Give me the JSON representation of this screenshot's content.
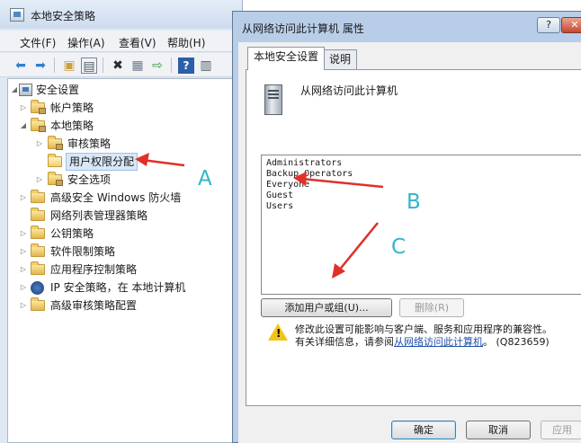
{
  "main_window": {
    "title": "本地安全策略",
    "menu": [
      "文件(F)",
      "操作(A)",
      "查看(V)",
      "帮助(H)"
    ],
    "toolbar_icons": [
      "back-arrow-icon",
      "forward-arrow-icon",
      "up-folder-icon",
      "show-hide-tree-icon",
      "delete-icon",
      "properties-icon",
      "export-icon",
      "help-icon",
      "view-icon"
    ],
    "tree": [
      {
        "label": "安全设置",
        "level": 0,
        "expanded": true,
        "icon": "computer"
      },
      {
        "label": "帐户策略",
        "level": 1,
        "expanded": false,
        "icon": "folder"
      },
      {
        "label": "本地策略",
        "level": 1,
        "expanded": true,
        "icon": "folder"
      },
      {
        "label": "审核策略",
        "level": 2,
        "expanded": false,
        "icon": "folder"
      },
      {
        "label": "用户权限分配",
        "level": 2,
        "expanded": null,
        "icon": "folder-open",
        "selected": true
      },
      {
        "label": "安全选项",
        "level": 2,
        "expanded": false,
        "icon": "folder"
      },
      {
        "label": "高级安全 Windows 防火墙",
        "level": 1,
        "expanded": false,
        "icon": "folder"
      },
      {
        "label": "网络列表管理器策略",
        "level": 1,
        "expanded": null,
        "icon": "folder"
      },
      {
        "label": "公钥策略",
        "level": 1,
        "expanded": false,
        "icon": "folder"
      },
      {
        "label": "软件限制策略",
        "level": 1,
        "expanded": false,
        "icon": "folder"
      },
      {
        "label": "应用程序控制策略",
        "level": 1,
        "expanded": false,
        "icon": "folder"
      },
      {
        "label": "IP 安全策略，在 本地计算机",
        "level": 1,
        "expanded": false,
        "icon": "ip"
      },
      {
        "label": "高级审核策略配置",
        "level": 1,
        "expanded": false,
        "icon": "folder"
      }
    ]
  },
  "dialog": {
    "title": "从网络访问此计算机 属性",
    "help_btn": "?",
    "close_btn": "✕",
    "tabs": [
      "本地安全设置",
      "说明"
    ],
    "policy_name": "从网络访问此计算机",
    "accounts": [
      "Administrators",
      "Backup Operators",
      "Everyone",
      "Guest",
      "Users"
    ],
    "add_button": "添加用户或组(U)...",
    "remove_button": "删除(R)",
    "warning_line1": "修改此设置可能影响与客户端、服务和应用程序的兼容性。",
    "warning_line2_prefix": "有关详细信息，请参阅",
    "warning_link": "从网络访问此计算机",
    "warning_suffix": "。 (Q823659)",
    "ok_button": "确定",
    "cancel_button": "取消",
    "apply_button": "应用"
  },
  "annotations": {
    "a": "A",
    "b": "B",
    "c": "C",
    "color": "#33b4c8",
    "arrow_color": "#e0302a"
  }
}
